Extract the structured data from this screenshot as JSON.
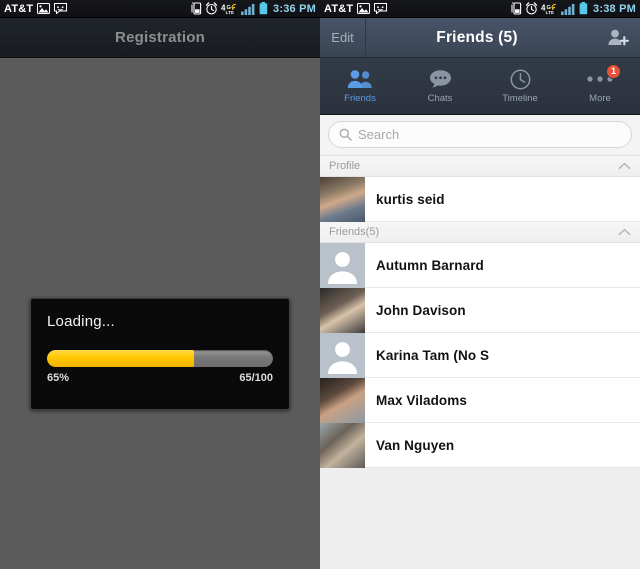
{
  "left": {
    "statusbar": {
      "carrier": "AT&T",
      "icons": [
        "image-icon",
        "message-icon",
        "vibrate-icon",
        "alarm-icon",
        "4glte-icon",
        "signal-icon",
        "battery-icon"
      ],
      "time": "3:36 PM"
    },
    "header": {
      "title": "Registration"
    },
    "dialog": {
      "title": "Loading...",
      "percent_label": "65%",
      "count_label": "65/100",
      "progress": 65,
      "fill_color": "#ffc800",
      "track_color": "#787878",
      "background": "#0a0a0a"
    },
    "background": "#5b5b5b"
  },
  "right": {
    "statusbar": {
      "carrier": "AT&T",
      "icons": [
        "image-icon",
        "message-icon",
        "vibrate-icon",
        "alarm-icon",
        "4glte-icon",
        "signal-icon",
        "battery-icon"
      ],
      "time": "3:38 PM"
    },
    "header": {
      "edit_label": "Edit",
      "title": "Friends (5)",
      "add_friend_icon": "add-person-icon",
      "background": "#3f4b5c"
    },
    "tabs": [
      {
        "label": "Friends",
        "icon": "friends-icon",
        "active": true,
        "badge": ""
      },
      {
        "label": "Chats",
        "icon": "chat-bubble-icon",
        "active": false,
        "badge": ""
      },
      {
        "label": "Timeline",
        "icon": "clock-icon",
        "active": false,
        "badge": ""
      },
      {
        "label": "More",
        "icon": "more-dots-icon",
        "active": false,
        "badge": "1"
      }
    ],
    "active_tab_color": "#5b9ce6",
    "badge_color": "#e8503a",
    "search": {
      "placeholder": "Search",
      "value": "",
      "icon": "search-icon"
    },
    "sections": [
      {
        "label": "Profile",
        "collapse_icon": "chevron-up-icon",
        "rows": [
          {
            "name": "kurtis seid",
            "avatar": "photo"
          }
        ]
      },
      {
        "label": "Friends(5)",
        "collapse_icon": "chevron-up-icon",
        "rows": [
          {
            "name": "Autumn Barnard",
            "avatar": "placeholder"
          },
          {
            "name": "John Davison",
            "avatar": "photo"
          },
          {
            "name": "Karina Tam (No S",
            "avatar": "placeholder"
          },
          {
            "name": "Max Viladoms",
            "avatar": "photo"
          },
          {
            "name": "Van Nguyen",
            "avatar": "photo"
          }
        ]
      }
    ]
  }
}
